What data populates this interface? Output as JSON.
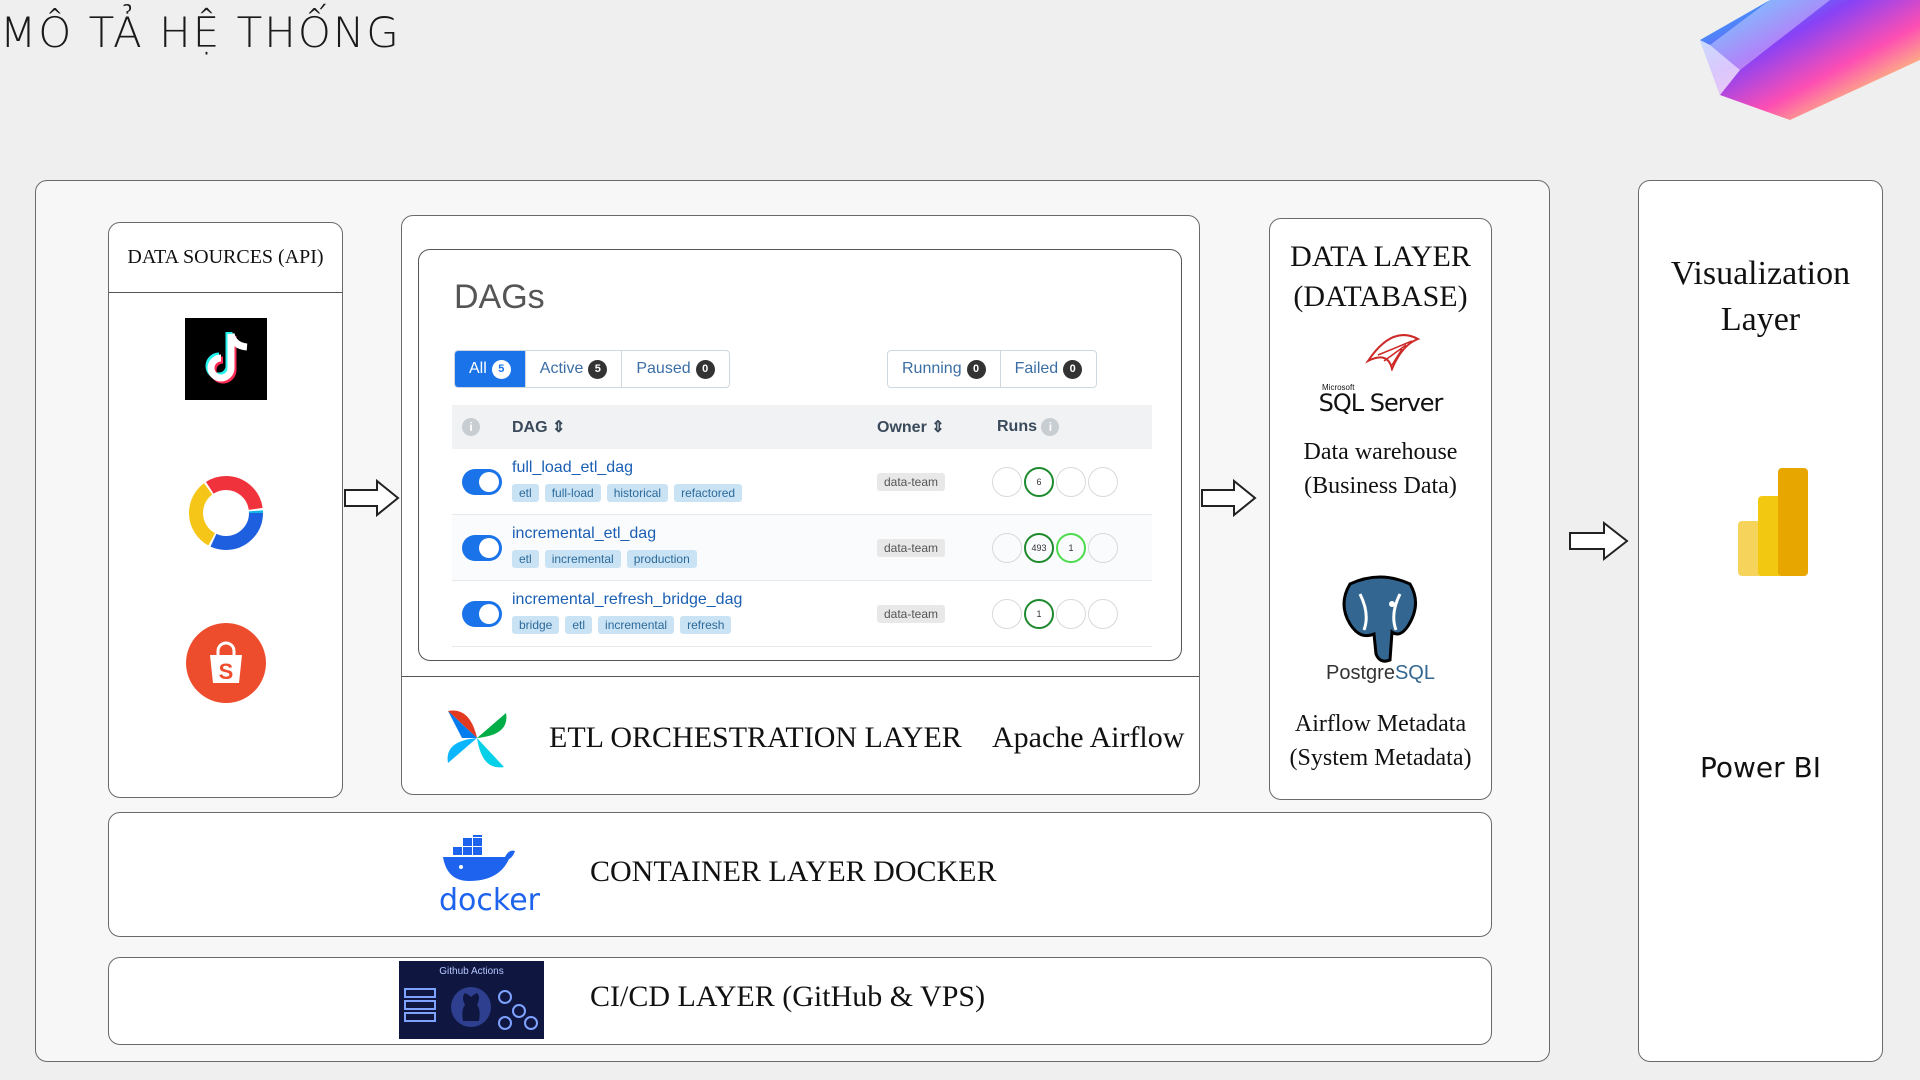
{
  "page": {
    "title": "MÔ TẢ HỆ THỐNG"
  },
  "sources": {
    "heading": "DATA SOURCES (API)",
    "items": [
      "tiktok-logo",
      "lazada-logo",
      "shopee-logo"
    ]
  },
  "airflow": {
    "panel_title": "DAGs",
    "filters": [
      {
        "label": "All",
        "count": "5"
      },
      {
        "label": "Active",
        "count": "5"
      },
      {
        "label": "Paused",
        "count": "0"
      }
    ],
    "status_filters": [
      {
        "label": "Running",
        "count": "0"
      },
      {
        "label": "Failed",
        "count": "0"
      }
    ],
    "columns": {
      "dag": "DAG",
      "owner": "Owner",
      "runs": "Runs"
    },
    "dags": [
      {
        "name": "full_load_etl_dag",
        "tags": [
          "etl",
          "full-load",
          "historical",
          "refactored"
        ],
        "owner": "data-team",
        "runs": [
          "",
          "6",
          "",
          ""
        ]
      },
      {
        "name": "incremental_etl_dag",
        "tags": [
          "etl",
          "incremental",
          "production"
        ],
        "owner": "data-team",
        "runs": [
          "",
          "493",
          "1",
          ""
        ]
      },
      {
        "name": "incremental_refresh_bridge_dag",
        "tags": [
          "bridge",
          "etl",
          "incremental",
          "refresh"
        ],
        "owner": "data-team",
        "runs": [
          "",
          "1",
          "",
          ""
        ]
      }
    ],
    "layer_label": "ETL ORCHESTRATION LAYER",
    "tool_label": "Apache Airflow"
  },
  "data_layer": {
    "heading_line1": "DATA LAYER",
    "heading_line2": "(DATABASE)",
    "sqlserver_small": "Microsoft",
    "sqlserver_logo": "SQL Server",
    "warehouse_line1": "Data  warehouse",
    "warehouse_line2": "(Business Data)",
    "postgres_logo_a": "Postgre",
    "postgres_logo_b": "SQL",
    "meta_line1": "Airflow Metadata",
    "meta_line2": "(System Metadata)"
  },
  "container": {
    "logo_text": "docker",
    "label": "CONTAINER LAYER  DOCKER"
  },
  "cicd": {
    "banner_text": "Github Actions",
    "label": "CI/CD LAYER (GitHub & VPS)"
  },
  "viz": {
    "title_line1": "Visualization",
    "title_line2": "Layer",
    "tool": "Power BI"
  },
  "colors": {
    "accent_blue": "#1a73e8",
    "success_green": "#1e8a2e",
    "docker_blue": "#1d63ed",
    "powerbi_yellow": "#f2c811"
  }
}
